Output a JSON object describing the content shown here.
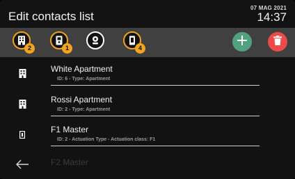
{
  "header": {
    "title": "Edit contacts list",
    "date": "07 MAG 2021",
    "time": "14:37"
  },
  "toolbar": {
    "filters": [
      {
        "icon": "building-icon",
        "count": "2"
      },
      {
        "icon": "door-entry-icon",
        "count": "1"
      },
      {
        "icon": "camera-icon",
        "count": ""
      },
      {
        "icon": "handset-icon",
        "count": "4"
      }
    ],
    "add_icon": "plus-icon",
    "delete_icon": "trash-icon"
  },
  "contacts": [
    {
      "name": "White Apartment",
      "details": "ID: 6 - Type: Apartment",
      "icon": "building-icon"
    },
    {
      "name": "Rossi Apartment",
      "details": "ID: 2 - Type: Apartment",
      "icon": "building-icon"
    },
    {
      "name": "F1 Master",
      "details": "ID: 2 - Actuation Type - Actuation class: F1",
      "icon": "handset-icon"
    },
    {
      "name": "F2 Master",
      "details": "",
      "icon": ""
    }
  ],
  "nav": {
    "back_icon": "back-arrow-icon"
  },
  "colors": {
    "accent": "#f2a51c",
    "toolbar": "#404040",
    "add": "#52a17f",
    "delete": "#ee4a4a"
  }
}
